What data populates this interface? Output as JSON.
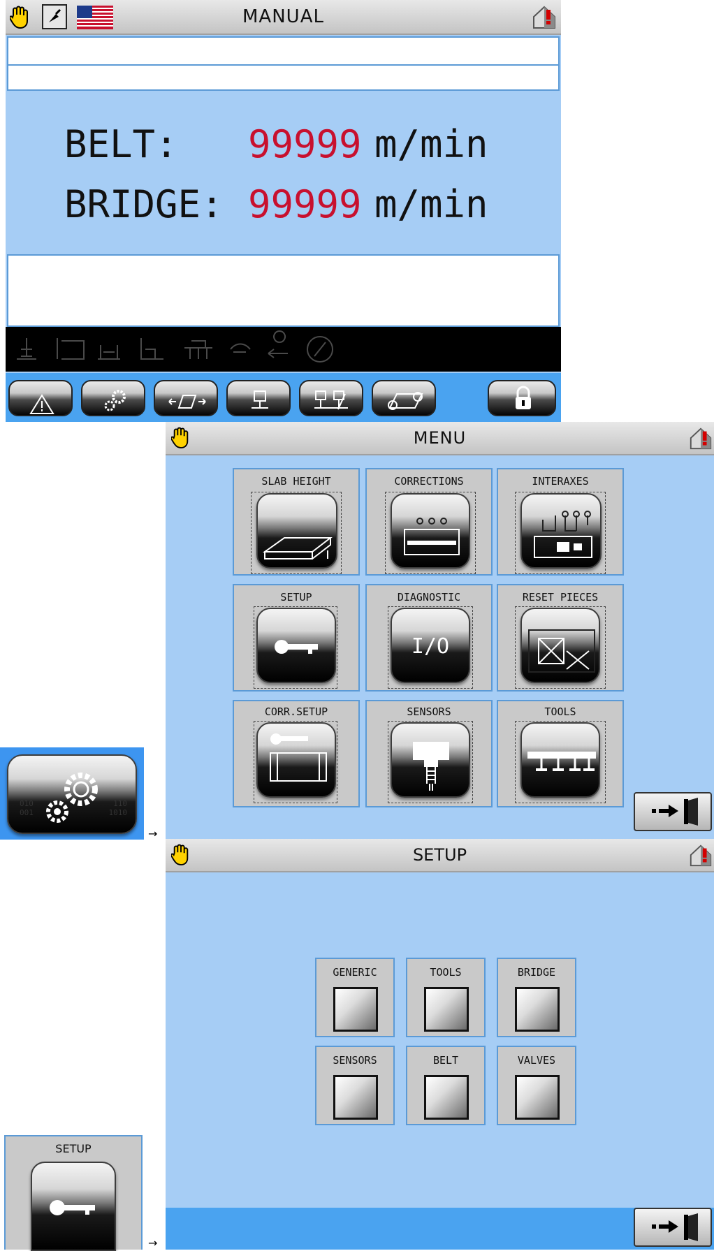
{
  "screen1": {
    "title": "MANUAL",
    "belt_label": "BELT:",
    "belt_value": "99999",
    "belt_unit": "m/min",
    "bridge_label": "BRIDGE:",
    "bridge_value": "99999",
    "bridge_unit": "m/min",
    "toolbar_icons": [
      "warning-icon",
      "gears-icon",
      "transfer-icon",
      "tool-down-icon",
      "tools-icon",
      "conveyor-icon",
      "lock-icon"
    ]
  },
  "screen2": {
    "title": "MENU",
    "tiles": [
      {
        "label": "SLAB HEIGHT",
        "icon": "slab-icon"
      },
      {
        "label": "CORRECTIONS",
        "icon": "corrections-icon"
      },
      {
        "label": "INTERAXES",
        "icon": "interaxes-icon"
      },
      {
        "label": "SETUP",
        "icon": "key-icon"
      },
      {
        "label": "DIAGNOSTIC",
        "icon": "io-icon"
      },
      {
        "label": "RESET PIECES",
        "icon": "reset-icon"
      },
      {
        "label": "CORR.SETUP",
        "icon": "key-box-icon"
      },
      {
        "label": "SENSORS",
        "icon": "sensor-icon"
      },
      {
        "label": "TOOLS",
        "icon": "tools-icon"
      }
    ],
    "diag_text": "I/O",
    "binary_left": "010\n001",
    "binary_right": "110\n1010"
  },
  "screen3": {
    "title": "SETUP",
    "tiles": [
      "GENERIC",
      "TOOLS",
      "BRIDGE",
      "SENSORS",
      "BELT",
      "VALVES"
    ],
    "setup_thumb_label": "SETUP"
  },
  "arrows": [
    "→",
    "→"
  ],
  "colors": {
    "accent_red": "#c8102e",
    "field_blue": "#a6cdf5",
    "border_blue": "#5b9ad6",
    "footer_blue": "#4aa3f0"
  }
}
